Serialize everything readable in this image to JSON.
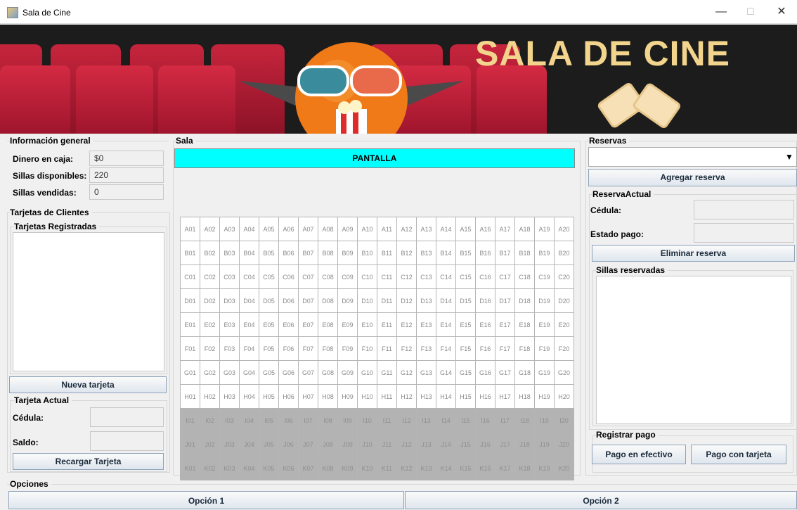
{
  "window": {
    "title": "Sala de Cine",
    "minimize": "—",
    "maximize": "☐",
    "close": "✕"
  },
  "banner": {
    "title": "SALA DE CINE"
  },
  "info": {
    "title": "Información general",
    "cash_label": "Dinero en caja:",
    "cash_value": "$0",
    "avail_label": "Sillas disponibles:",
    "avail_value": "220",
    "sold_label": "Sillas vendidas:",
    "sold_value": "0"
  },
  "cards": {
    "title": "Tarjetas de Clientes",
    "registered_title": "Tarjetas Registradas",
    "new_button": "Nueva tarjeta",
    "current_title": "Tarjeta Actual",
    "id_label": "Cédula:",
    "id_value": "",
    "balance_label": "Saldo:",
    "balance_value": "",
    "recharge_button": "Recargar Tarjeta"
  },
  "sala": {
    "title": "Sala",
    "screen": "PANTALLA",
    "rows": [
      "A",
      "B",
      "C",
      "D",
      "E",
      "F",
      "G",
      "H",
      "I",
      "J",
      "K"
    ],
    "sold_rows": [
      "I",
      "J",
      "K"
    ],
    "seats_per_row": 20
  },
  "reservas": {
    "title": "Reservas",
    "selected": "",
    "add_button": "Agregar reserva",
    "current_title": "ReservaActual",
    "id_label": "Cédula:",
    "id_value": "",
    "status_label": "Estado pago:",
    "status_value": "",
    "delete_button": "Eliminar reserva",
    "reserved_title": "Sillas reservadas",
    "pay_title": "Registrar pago",
    "cash_button": "Pago en efectivo",
    "card_button": "Pago con tarjeta"
  },
  "options": {
    "title": "Opciones",
    "opt1": "Opción 1",
    "opt2": "Opción 2"
  }
}
